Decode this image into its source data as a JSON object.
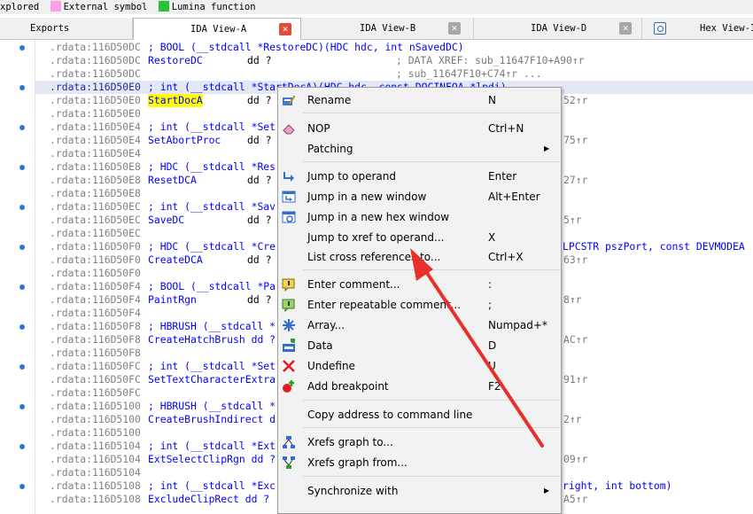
{
  "legend": {
    "items": [
      {
        "label": "xplored",
        "color": ""
      },
      {
        "label": "External symbol",
        "color": "#ff9ee5"
      },
      {
        "label": "Lumina function",
        "color": "#27c23a"
      }
    ]
  },
  "tabs": [
    {
      "label": "Exports",
      "close": "none"
    },
    {
      "label": "IDA View-A",
      "close": "red"
    },
    {
      "label": "IDA View-B",
      "close": "gray"
    },
    {
      "label": "IDA View-D",
      "close": "gray"
    },
    {
      "label": "Hex View-1",
      "close": "icon"
    }
  ],
  "code": [
    {
      "addr": ".rdata:116D50DC",
      "text": "; BOOL (__stdcall *RestoreDC)(HDC hdc, int nSavedDC)",
      "kind": "comment",
      "dot": true
    },
    {
      "addr": ".rdata:116D50DC",
      "name": "RestoreDC",
      "dd": "dd ?",
      "ref": "; DATA XREF: sub_11647F10+A90↑r",
      "dot": false
    },
    {
      "addr": ".rdata:116D50DC",
      "name": "",
      "dd": "",
      "ref": "; sub_11647F10+C74↑r ...",
      "dot": false
    },
    {
      "addr": ".rdata:116D50E0",
      "text": "; int (__stdcall *StartDocA)(HDC hdc, const DOCINFOA *lpdi)",
      "kind": "comment",
      "cur": true,
      "dot": true
    },
    {
      "addr": ".rdata:116D50E0",
      "name": "StartDocA",
      "dd": "dd ?",
      "ref": "52↑r",
      "hl": true,
      "dot": false
    },
    {
      "addr": ".rdata:116D50E0",
      "name": "",
      "dd": "",
      "ref": "",
      "dot": false
    },
    {
      "addr": ".rdata:116D50E4",
      "text": "; int (__stdcall *Set",
      "kind": "comment",
      "dot": true
    },
    {
      "addr": ".rdata:116D50E4",
      "name": "SetAbortProc",
      "dd": "dd ?",
      "ref": "75↑r",
      "dot": false
    },
    {
      "addr": ".rdata:116D50E4",
      "name": "",
      "dd": "",
      "ref": "",
      "dot": false
    },
    {
      "addr": ".rdata:116D50E8",
      "text": "; HDC (__stdcall *Res",
      "kind": "comment",
      "dot": true
    },
    {
      "addr": ".rdata:116D50E8",
      "name": "ResetDCA",
      "dd": "dd ?",
      "ref": "27↑r",
      "dot": false
    },
    {
      "addr": ".rdata:116D50E8",
      "name": "",
      "dd": "",
      "ref": "",
      "dot": false
    },
    {
      "addr": ".rdata:116D50EC",
      "text": "; int (__stdcall *Sav",
      "kind": "comment",
      "dot": true
    },
    {
      "addr": ".rdata:116D50EC",
      "name": "SaveDC",
      "dd": "dd ?",
      "ref": "5↑r",
      "dot": false
    },
    {
      "addr": ".rdata:116D50EC",
      "name": "",
      "dd": "",
      "ref": "",
      "dot": false
    },
    {
      "addr": ".rdata:116D50F0",
      "text": "; HDC (__stdcall *Cre",
      "kind": "comment",
      "tail": "LPCSTR pszPort, const DEVMODEA",
      "dot": true
    },
    {
      "addr": ".rdata:116D50F0",
      "name": "CreateDCA",
      "dd": "dd ?",
      "ref": "63↑r",
      "dot": false
    },
    {
      "addr": ".rdata:116D50F0",
      "name": "",
      "dd": "",
      "ref": "",
      "dot": false
    },
    {
      "addr": ".rdata:116D50F4",
      "text": "; BOOL (__stdcall *Pa",
      "kind": "comment",
      "dot": true
    },
    {
      "addr": ".rdata:116D50F4",
      "name": "PaintRgn",
      "dd": "dd ?",
      "ref": "8↑r",
      "dot": false
    },
    {
      "addr": ".rdata:116D50F4",
      "name": "",
      "dd": "",
      "ref": "",
      "dot": false
    },
    {
      "addr": ".rdata:116D50F8",
      "text": "; HBRUSH (__stdcall *",
      "kind": "comment",
      "dot": true
    },
    {
      "addr": ".rdata:116D50F8",
      "name": "CreateHatchBrush dd ?",
      "dd": "",
      "ref": "AC↑r",
      "dot": false
    },
    {
      "addr": ".rdata:116D50F8",
      "name": "",
      "dd": "",
      "ref": "",
      "dot": false
    },
    {
      "addr": ".rdata:116D50FC",
      "text": "; int (__stdcall *Set",
      "kind": "comment",
      "dot": true
    },
    {
      "addr": ".rdata:116D50FC",
      "name": "SetTextCharacterExtra",
      "dd": "",
      "ref": "91↑r",
      "dot": false
    },
    {
      "addr": ".rdata:116D50FC",
      "name": "",
      "dd": "",
      "ref": "",
      "dot": false
    },
    {
      "addr": ".rdata:116D5100",
      "text": "; HBRUSH (__stdcall *",
      "kind": "comment",
      "dot": true
    },
    {
      "addr": ".rdata:116D5100",
      "name": "CreateBrushIndirect d",
      "dd": "",
      "ref": "2↑r",
      "dot": false
    },
    {
      "addr": ".rdata:116D5100",
      "name": "",
      "dd": "",
      "ref": "",
      "dot": false
    },
    {
      "addr": ".rdata:116D5104",
      "text": "; int (__stdcall *Ext",
      "kind": "comment",
      "dot": true
    },
    {
      "addr": ".rdata:116D5104",
      "name": "ExtSelectClipRgn dd ?",
      "dd": "",
      "ref": "09↑r",
      "dot": false
    },
    {
      "addr": ".rdata:116D5104",
      "name": "",
      "dd": "",
      "ref": "",
      "dot": false
    },
    {
      "addr": ".rdata:116D5108",
      "text": "; int (__stdcall *Exc",
      "kind": "comment",
      "tail": "right, int bottom)",
      "dot": true
    },
    {
      "addr": ".rdata:116D5108",
      "name": "ExcludeClipRect dd ?",
      "dd": "",
      "ref": "A5↑r",
      "dot": false
    }
  ],
  "menu": {
    "items": [
      {
        "label": "Rename",
        "key": "N",
        "icon": "rename-icon"
      },
      {
        "sep": true
      },
      {
        "label": "NOP",
        "key": "Ctrl+N",
        "icon": "eraser-icon"
      },
      {
        "label": "Patching",
        "key": "",
        "sub": true
      },
      {
        "sep": true
      },
      {
        "label": "Jump to operand",
        "key": "Enter",
        "icon": "jump-arrow-icon"
      },
      {
        "label": "Jump in a new window",
        "key": "Alt+Enter",
        "icon": "new-window-icon"
      },
      {
        "label": "Jump in a new hex window",
        "key": "",
        "icon": "hex-window-icon"
      },
      {
        "label": "Jump to xref to operand...",
        "key": "X"
      },
      {
        "label": "List cross references to...",
        "key": "Ctrl+X"
      },
      {
        "sep": true
      },
      {
        "label": "Enter comment...",
        "key": ":",
        "icon": "comment-icon"
      },
      {
        "label": "Enter repeatable comment...",
        "key": ";",
        "icon": "repeatable-comment-icon"
      },
      {
        "label": "Array...",
        "key": "Numpad+*",
        "icon": "array-icon"
      },
      {
        "label": "Data",
        "key": "D",
        "icon": "data-icon"
      },
      {
        "label": "Undefine",
        "key": "U",
        "icon": "undefine-icon"
      },
      {
        "label": "Add breakpoint",
        "key": "F2",
        "icon": "breakpoint-icon"
      },
      {
        "sep": true
      },
      {
        "label": "Copy address to command line",
        "key": ""
      },
      {
        "sep": true
      },
      {
        "label": "Xrefs graph to...",
        "key": "",
        "icon": "xrefs-graph-to-icon"
      },
      {
        "label": "Xrefs graph from...",
        "key": "",
        "icon": "xrefs-graph-from-icon"
      },
      {
        "sep": true
      },
      {
        "label": "Synchronize with",
        "key": "",
        "sub": true
      }
    ]
  },
  "colors": {
    "accent": "#0000ff",
    "highlight": "#ffff00",
    "arrow": "#e8302a"
  }
}
